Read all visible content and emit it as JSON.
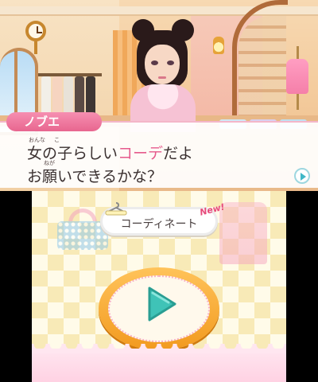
{
  "top_screen": {
    "speaker_name": "ノブエ",
    "dialogue": {
      "line1_part1": "女の子らしい",
      "line1_highlight": "コーデ",
      "line1_part2": "だよ",
      "line2": "お願いできるかな？",
      "ruby_onna": "おんな",
      "ruby_ko": "こ",
      "ruby_negai": "ねが"
    }
  },
  "bottom_screen": {
    "coordinate_label": "コーディネート",
    "new_badge": "New!"
  },
  "colors": {
    "highlight_pink": "#e65a8c",
    "name_tag_pink": "#e8668f",
    "play_teal": "#3fc3b7",
    "bubble_orange": "#f29a1f"
  }
}
